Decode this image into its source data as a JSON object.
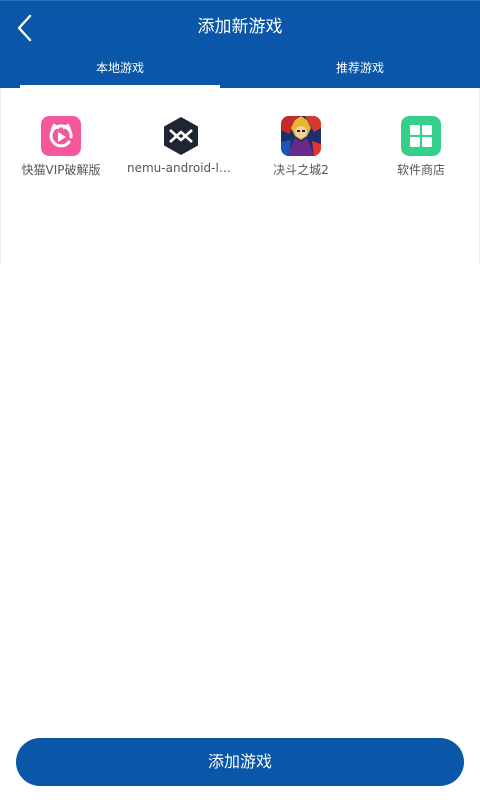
{
  "header": {
    "title": "添加新游戏",
    "back_icon": "chevron-left-icon",
    "background_color": "#0a56a8"
  },
  "tabs": [
    {
      "label": "本地游戏",
      "selected": true
    },
    {
      "label": "推荐游戏",
      "selected": false
    }
  ],
  "games": [
    {
      "name": "快猫VIP破解版",
      "icon": "kuaimao-cat-icon"
    },
    {
      "name": "nemu-android-laun...",
      "icon": "nemu-launcher-icon"
    },
    {
      "name": "决斗之城2",
      "icon": "duel-links-icon"
    },
    {
      "name": "软件商店",
      "icon": "app-store-icon"
    }
  ],
  "footer": {
    "add_button_label": "添加游戏"
  }
}
